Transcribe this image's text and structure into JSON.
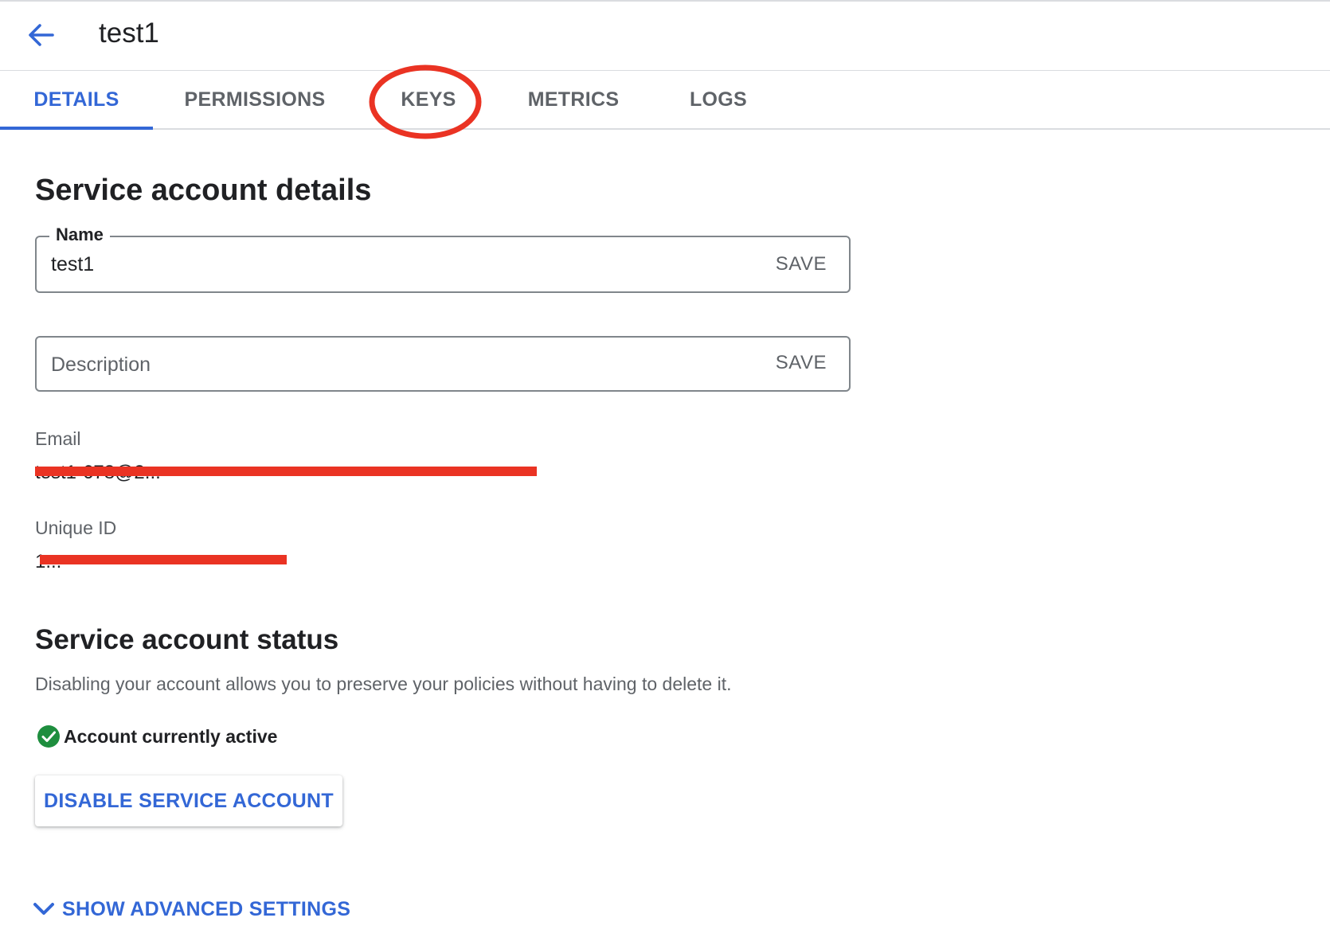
{
  "header": {
    "title": "test1",
    "back_icon": "arrow-left-icon"
  },
  "tabs": [
    {
      "label": "DETAILS",
      "active": true
    },
    {
      "label": "PERMISSIONS",
      "active": false
    },
    {
      "label": "KEYS",
      "active": false,
      "annotated": true
    },
    {
      "label": "METRICS",
      "active": false
    },
    {
      "label": "LOGS",
      "active": false
    }
  ],
  "details": {
    "heading": "Service account details",
    "name_field": {
      "label": "Name",
      "value": "test1",
      "save_label": "SAVE"
    },
    "description_field": {
      "placeholder": "Description",
      "value": "",
      "save_label": "SAVE"
    },
    "email": {
      "label": "Email",
      "value": "test1-678@2..."
    },
    "unique_id": {
      "label": "Unique ID",
      "value": "1..."
    }
  },
  "status": {
    "heading": "Service account status",
    "description": "Disabling your account allows you to preserve your policies without having to delete it.",
    "state_text": "Account currently active",
    "state_icon": "check-circle-icon",
    "disable_label": "DISABLE SERVICE ACCOUNT"
  },
  "advanced": {
    "label": "SHOW ADVANCED SETTINGS",
    "icon": "chevron-down-icon"
  },
  "colors": {
    "accent": "#3367d6",
    "active_green": "#1e8e3e",
    "annotation_red": "#ea3323",
    "text_secondary": "#5f6368"
  }
}
